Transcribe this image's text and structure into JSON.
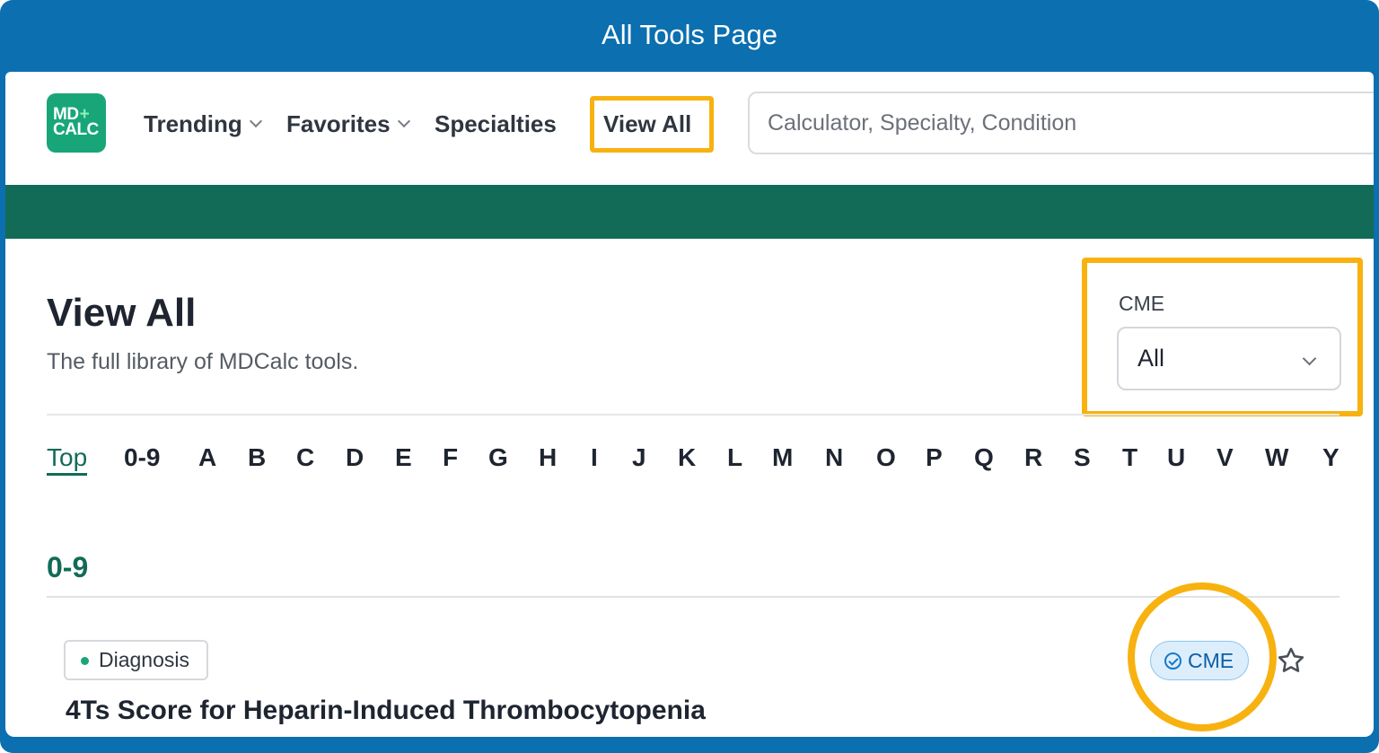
{
  "frame": {
    "title": "All Tools Page"
  },
  "header": {
    "logo": {
      "line1": "MD",
      "plus": "+",
      "line2": "CALC"
    },
    "nav": [
      {
        "label": "Trending",
        "has_dropdown": true
      },
      {
        "label": "Favorites",
        "has_dropdown": true
      },
      {
        "label": "Specialties",
        "has_dropdown": false
      },
      {
        "label": "View All",
        "has_dropdown": false,
        "highlighted": true
      }
    ],
    "search": {
      "placeholder": "Calculator, Specialty, Condition",
      "value": ""
    }
  },
  "page": {
    "title": "View All",
    "subtitle": "The full library of MDCalc tools."
  },
  "cme_filter": {
    "label": "CME",
    "selected": "All",
    "highlighted": true
  },
  "alphabet": {
    "active": "Top",
    "items": [
      "Top",
      "0-9",
      "A",
      "B",
      "C",
      "D",
      "E",
      "F",
      "G",
      "H",
      "I",
      "J",
      "K",
      "L",
      "M",
      "N",
      "O",
      "P",
      "Q",
      "R",
      "S",
      "T",
      "U",
      "V",
      "W",
      "Y"
    ]
  },
  "sections": [
    {
      "heading": "0-9",
      "items": [
        {
          "tag": "Diagnosis",
          "badge": "CME",
          "favorited": false,
          "title": "4Ts Score for Heparin-Induced Thrombocytopenia"
        }
      ]
    }
  ],
  "colors": {
    "frame_blue": "#0b6fb0",
    "brand_green": "#18a678",
    "band_green": "#126b57",
    "highlight_amber": "#f7b210",
    "cme_blue": "#0d5ea6"
  },
  "icons": [
    "chevron-down-icon",
    "check-circle-icon",
    "star-outline-icon"
  ]
}
